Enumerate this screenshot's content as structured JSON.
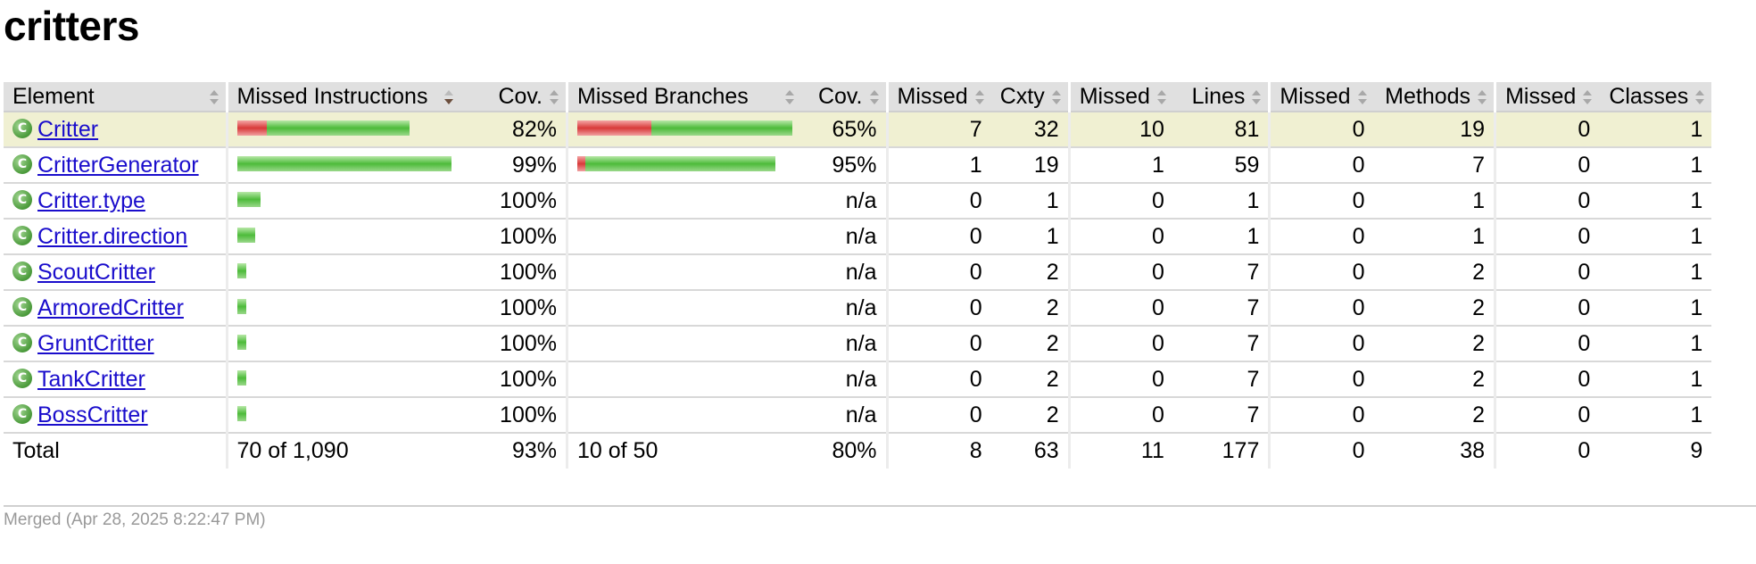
{
  "title": "critters",
  "headers": {
    "element": "Element",
    "missed_instructions": "Missed Instructions",
    "cov_instructions": "Cov.",
    "missed_branches": "Missed Branches",
    "cov_branches": "Cov.",
    "missed_cxty": "Missed",
    "cxty": "Cxty",
    "missed_lines": "Missed",
    "lines": "Lines",
    "missed_methods": "Missed",
    "methods": "Methods",
    "missed_classes": "Missed",
    "classes": "Classes"
  },
  "rows": [
    {
      "name": "Critter",
      "highlight": true,
      "instr_bar": {
        "red": 33,
        "green": 160
      },
      "instr_cov": "82%",
      "branch_bar": {
        "red": 83,
        "green": 158
      },
      "branch_cov": "65%",
      "missed_cxty": "7",
      "cxty": "32",
      "missed_lines": "10",
      "lines": "81",
      "missed_methods": "0",
      "methods": "19",
      "missed_classes": "0",
      "classes": "1"
    },
    {
      "name": "CritterGenerator",
      "highlight": false,
      "instr_bar": {
        "red": 0,
        "green": 240
      },
      "instr_cov": "99%",
      "branch_bar": {
        "red": 9,
        "green": 213
      },
      "branch_cov": "95%",
      "missed_cxty": "1",
      "cxty": "19",
      "missed_lines": "1",
      "lines": "59",
      "missed_methods": "0",
      "methods": "7",
      "missed_classes": "0",
      "classes": "1"
    },
    {
      "name": "Critter.type",
      "highlight": false,
      "instr_bar": {
        "red": 0,
        "green": 26
      },
      "instr_cov": "100%",
      "branch_bar": null,
      "branch_cov": "n/a",
      "missed_cxty": "0",
      "cxty": "1",
      "missed_lines": "0",
      "lines": "1",
      "missed_methods": "0",
      "methods": "1",
      "missed_classes": "0",
      "classes": "1"
    },
    {
      "name": "Critter.direction",
      "highlight": false,
      "instr_bar": {
        "red": 0,
        "green": 20
      },
      "instr_cov": "100%",
      "branch_bar": null,
      "branch_cov": "n/a",
      "missed_cxty": "0",
      "cxty": "1",
      "missed_lines": "0",
      "lines": "1",
      "missed_methods": "0",
      "methods": "1",
      "missed_classes": "0",
      "classes": "1"
    },
    {
      "name": "ScoutCritter",
      "highlight": false,
      "instr_bar": {
        "red": 0,
        "green": 10
      },
      "instr_cov": "100%",
      "branch_bar": null,
      "branch_cov": "n/a",
      "missed_cxty": "0",
      "cxty": "2",
      "missed_lines": "0",
      "lines": "7",
      "missed_methods": "0",
      "methods": "2",
      "missed_classes": "0",
      "classes": "1"
    },
    {
      "name": "ArmoredCritter",
      "highlight": false,
      "instr_bar": {
        "red": 0,
        "green": 10
      },
      "instr_cov": "100%",
      "branch_bar": null,
      "branch_cov": "n/a",
      "missed_cxty": "0",
      "cxty": "2",
      "missed_lines": "0",
      "lines": "7",
      "missed_methods": "0",
      "methods": "2",
      "missed_classes": "0",
      "classes": "1"
    },
    {
      "name": "GruntCritter",
      "highlight": false,
      "instr_bar": {
        "red": 0,
        "green": 10
      },
      "instr_cov": "100%",
      "branch_bar": null,
      "branch_cov": "n/a",
      "missed_cxty": "0",
      "cxty": "2",
      "missed_lines": "0",
      "lines": "7",
      "missed_methods": "0",
      "methods": "2",
      "missed_classes": "0",
      "classes": "1"
    },
    {
      "name": "TankCritter",
      "highlight": false,
      "instr_bar": {
        "red": 0,
        "green": 10
      },
      "instr_cov": "100%",
      "branch_bar": null,
      "branch_cov": "n/a",
      "missed_cxty": "0",
      "cxty": "2",
      "missed_lines": "0",
      "lines": "7",
      "missed_methods": "0",
      "methods": "2",
      "missed_classes": "0",
      "classes": "1"
    },
    {
      "name": "BossCritter",
      "highlight": false,
      "instr_bar": {
        "red": 0,
        "green": 10
      },
      "instr_cov": "100%",
      "branch_bar": null,
      "branch_cov": "n/a",
      "missed_cxty": "0",
      "cxty": "2",
      "missed_lines": "0",
      "lines": "7",
      "missed_methods": "0",
      "methods": "2",
      "missed_classes": "0",
      "classes": "1"
    }
  ],
  "total": {
    "label": "Total",
    "missed_instructions": "70 of 1,090",
    "instr_cov": "93%",
    "missed_branches": "10 of 50",
    "branch_cov": "80%",
    "missed_cxty": "8",
    "cxty": "63",
    "missed_lines": "11",
    "lines": "177",
    "missed_methods": "0",
    "methods": "38",
    "missed_classes": "0",
    "classes": "9"
  },
  "footer": "Merged (Apr 28, 2025 8:22:47 PM)",
  "colors": {
    "covered": "#4dbb3a",
    "missed": "#d83a3a",
    "highlight_row": "#f0f0d2",
    "header_bg": "#e0e0e0",
    "link": "#1a0dcc"
  }
}
